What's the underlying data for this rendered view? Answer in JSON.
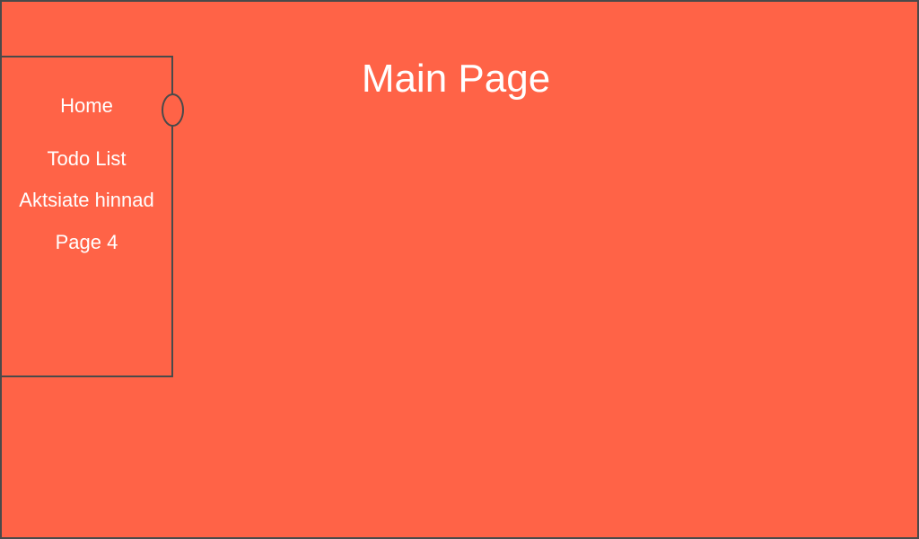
{
  "colors": {
    "background": "#ff6347",
    "border": "#4a4a4a",
    "text": "#ffffff"
  },
  "main": {
    "title": "Main Page"
  },
  "sidebar": {
    "items": [
      {
        "label": "Home"
      },
      {
        "label": "Todo List"
      },
      {
        "label": "Aktsiate hinnad"
      },
      {
        "label": "Page 4"
      }
    ]
  }
}
